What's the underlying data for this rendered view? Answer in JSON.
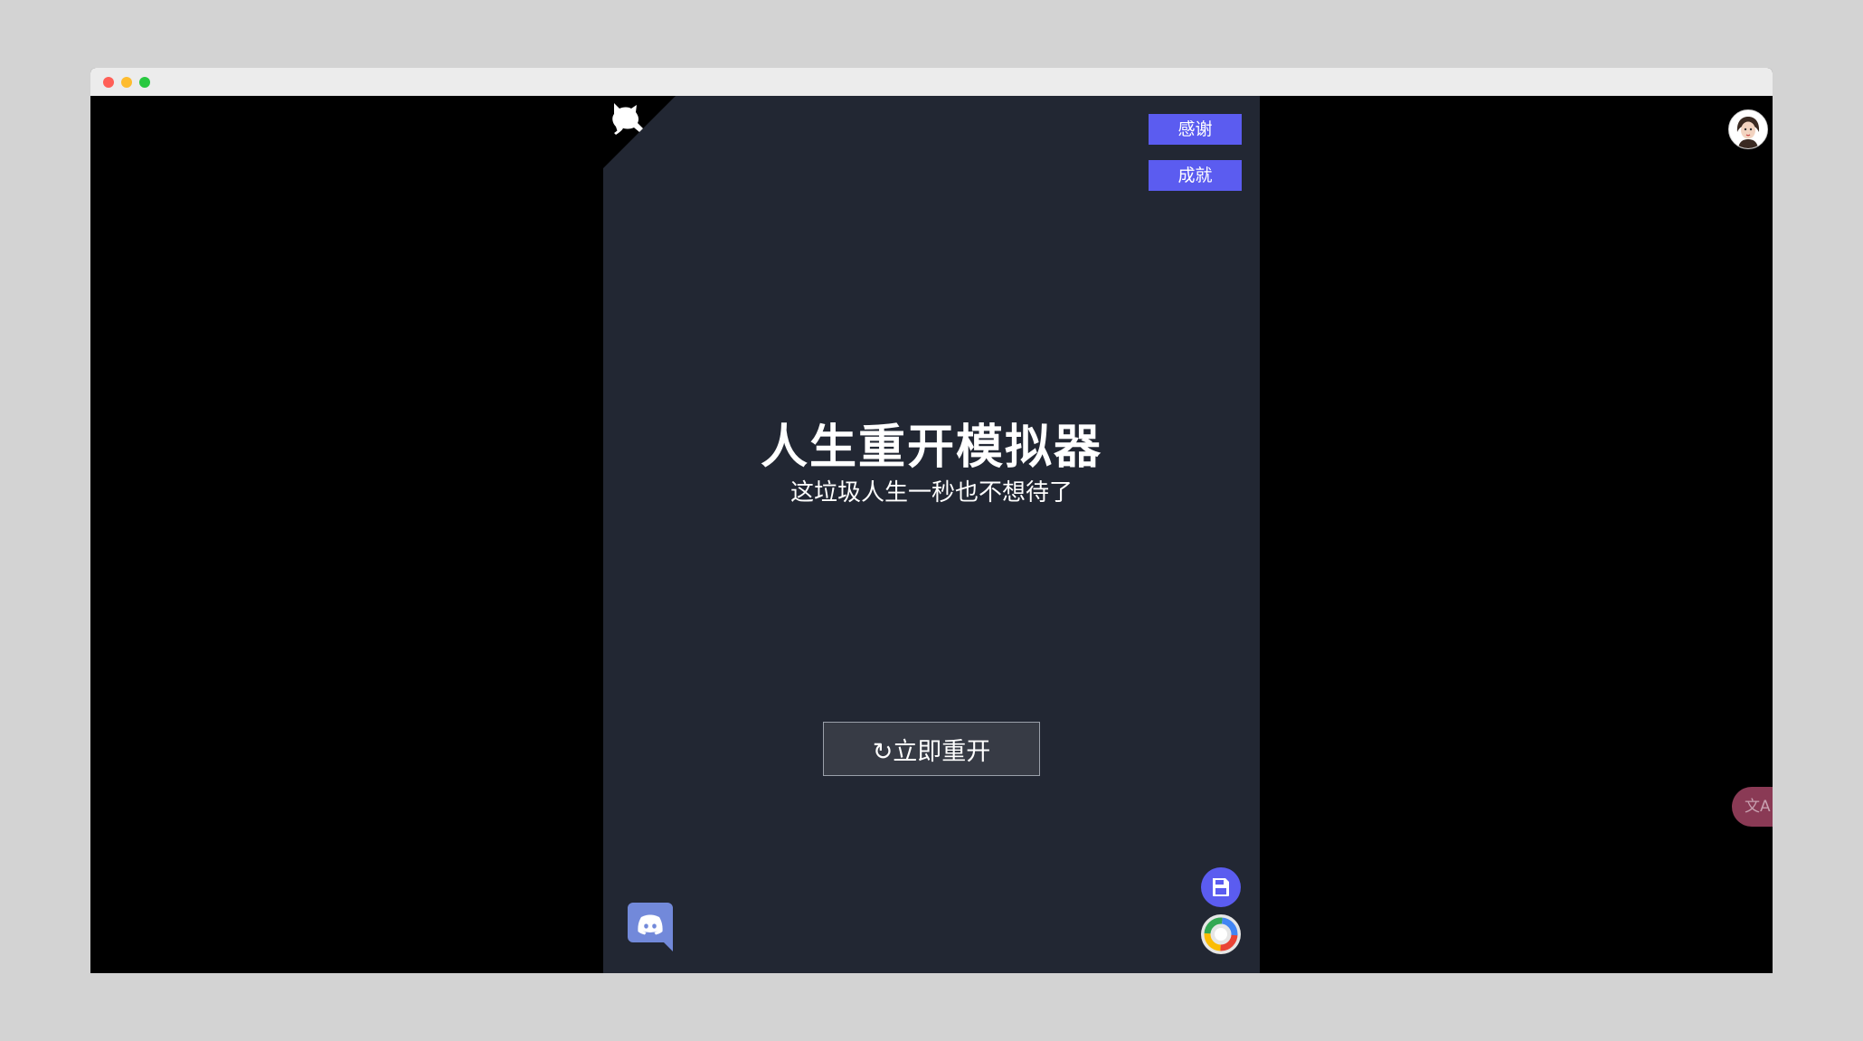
{
  "window": {
    "title": ""
  },
  "header": {
    "thanks_label": "感谢",
    "achievements_label": "成就"
  },
  "main": {
    "title": "人生重开模拟器",
    "subtitle": "这垃圾人生一秒也不想待了",
    "restart_label": "↻立即重开"
  },
  "side": {
    "translate_label": "文A"
  },
  "icons": {
    "corner": "github-octocat-icon",
    "discord": "discord-icon",
    "save": "save-icon",
    "theme": "theme-color-icon",
    "avatar": "user-avatar-icon"
  },
  "colors": {
    "panel_bg": "#222733",
    "accent": "#5b5cf0",
    "page_bg": "#000000",
    "discord": "#7289da"
  }
}
